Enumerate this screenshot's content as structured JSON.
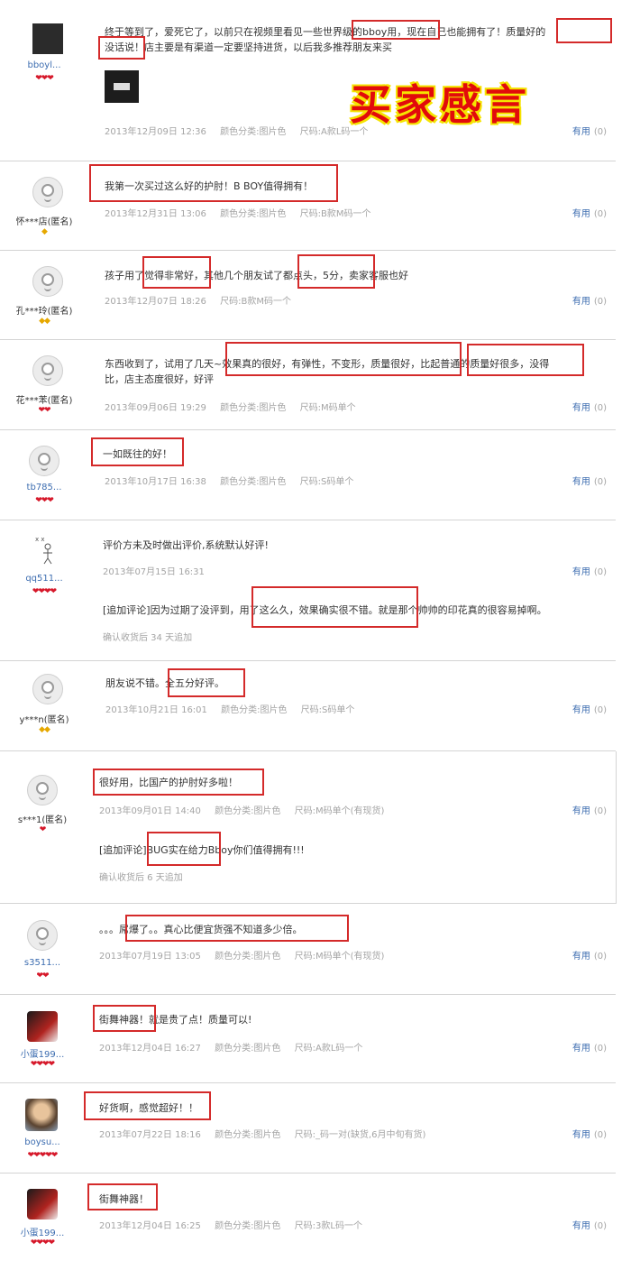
{
  "banner": {
    "title": "买家感言"
  },
  "reviews": [
    {
      "user": "bboyl...",
      "rank": "❤❤❤",
      "text": "终于等到了，爱死它了，以前只在视频里看见一些世界级的bboy用，现在自己也能拥有了！质量好的",
      "text2": "没话说！店主要是有渠道一定要坚持进货，以后我多推荐朋友来买",
      "date": "2013年12月09日 12:36",
      "color": "颜色分类:图片色",
      "size": "尺码:A款L码一个",
      "useful": "有用",
      "useful_count": "(0)"
    },
    {
      "user": "怀***店(匿名)",
      "rank": "◆",
      "text": "我第一次买过这么好的护肘！B BOY值得拥有！",
      "date": "2013年12月31日 13:06",
      "color": "颜色分类:图片色",
      "size": "尺码:B款M码一个",
      "useful": "有用",
      "useful_count": "(0)"
    },
    {
      "user": "孔***玲(匿名)",
      "rank": "◆◆",
      "text": "孩子用了觉得非常好，其他几个朋友试了都点头，5分，卖家客服也好",
      "date": "2013年12月07日 18:26",
      "color": "",
      "size": "尺码:B款M码一个",
      "useful": "有用",
      "useful_count": "(0)"
    },
    {
      "user": "花***苯(匿名)",
      "rank": "❤❤",
      "text": "东西收到了，试用了几天~效果真的很好，有弹性，不变形，质量很好，比起普通的质量好很多，没得",
      "text2": "比，店主态度很好，好评",
      "date": "2013年09月06日 19:29",
      "color": "颜色分类:图片色",
      "size": "尺码:M码单个",
      "useful": "有用",
      "useful_count": "(0)"
    },
    {
      "user": "tb785...",
      "rank": "❤❤❤",
      "text": "一如既往的好！",
      "date": "2013年10月17日 16:38",
      "color": "颜色分类:图片色",
      "size": "尺码:S码单个",
      "useful": "有用",
      "useful_count": "(0)"
    },
    {
      "user": "qq511...",
      "rank": "❤❤❤❤",
      "text": "评价方未及时做出评价,系统默认好评!",
      "date": "2013年07月15日 16:31",
      "append": "[追加评论]因为过期了没评到，用了这么久，效果确实很不错。就是那个帅帅的印花真的很容易掉啊。",
      "append_meta": "确认收货后 34 天追加",
      "useful": "有用",
      "useful_count": "(0)"
    },
    {
      "user": "y***n(匿名)",
      "rank": "◆◆",
      "text": "朋友说不错。全五分好评。",
      "date": "2013年10月21日 16:01",
      "color": "颜色分类:图片色",
      "size": "尺码:S码单个",
      "useful": "有用",
      "useful_count": "(0)"
    },
    {
      "user": "s***1(匿名)",
      "rank": "❤",
      "text": "很好用，比国产的护肘好多啦！",
      "date": "2013年09月01日 14:40",
      "color": "颜色分类:图片色",
      "size": "尺码:M码单个(有现货)",
      "append": "[追加评论]BUG实在给力Bboy你们值得拥有!!!",
      "append_meta": "确认收货后 6 天追加",
      "useful": "有用",
      "useful_count": "(0)"
    },
    {
      "user": "s3511...",
      "rank": "❤❤",
      "text": "。。。屌爆了。。真心比便宜货强不知道多少倍。",
      "date": "2013年07月19日 13:05",
      "color": "颜色分类:图片色",
      "size": "尺码:M码单个(有现货)",
      "useful": "有用",
      "useful_count": "(0)"
    },
    {
      "user": "小蛋199...",
      "rank": "❤❤❤❤",
      "text": "街舞神器！就是贵了点！质量可以!",
      "date": "2013年12月04日 16:27",
      "color": "颜色分类:图片色",
      "size": "尺码:A款L码一个",
      "useful": "有用",
      "useful_count": "(0)"
    },
    {
      "user": "boysu...",
      "rank": "❤❤❤❤❤",
      "text": "好货啊，感觉超好！！",
      "date": "2013年07月22日 18:16",
      "color": "颜色分类:图片色",
      "size": "尺码:_码一对(缺货,6月中旬有货)",
      "useful": "有用",
      "useful_count": "(0)"
    },
    {
      "user": "小蛋199...",
      "rank": "❤❤❤❤",
      "text": "街舞神器！",
      "date": "2013年12月04日 16:25",
      "color": "颜色分类:图片色",
      "size": "尺码:3款L码一个",
      "useful": "有用",
      "useful_count": "(0)"
    }
  ]
}
